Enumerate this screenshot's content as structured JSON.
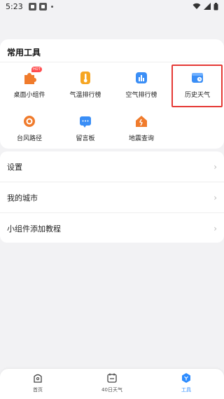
{
  "status_bar": {
    "time": "5:23"
  },
  "tools": {
    "title": "常用工具",
    "items": [
      {
        "label": "桌面小组件",
        "icon": "puzzle-icon",
        "badge": "HOT"
      },
      {
        "label": "气温排行榜",
        "icon": "thermometer-icon"
      },
      {
        "label": "空气排行榜",
        "icon": "bar-chart-icon"
      },
      {
        "label": "历史天气",
        "icon": "history-calendar-icon"
      },
      {
        "label": "台风路径",
        "icon": "typhoon-icon"
      },
      {
        "label": "留言板",
        "icon": "message-board-icon"
      },
      {
        "label": "地震查询",
        "icon": "earthquake-icon"
      }
    ]
  },
  "menu": {
    "items": [
      {
        "label": "设置"
      },
      {
        "label": "我的城市"
      },
      {
        "label": "小组件添加教程"
      }
    ]
  },
  "bottom_nav": {
    "items": [
      {
        "label": "首页",
        "icon": "home-icon"
      },
      {
        "label": "40日天气",
        "icon": "calendar-icon"
      },
      {
        "label": "工具",
        "icon": "tools-icon",
        "active": true
      }
    ]
  },
  "colors": {
    "accent": "#2d8cff",
    "highlight": "#e53935",
    "hot_badge": "#ff4d4f"
  }
}
